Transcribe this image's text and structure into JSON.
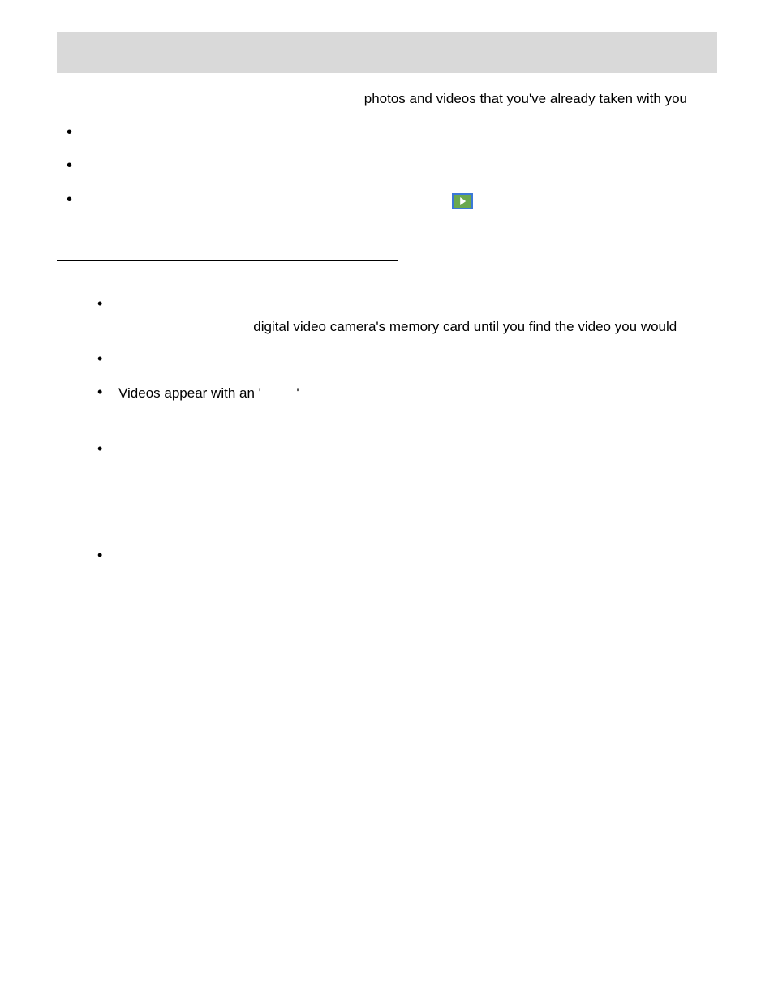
{
  "intro": {
    "t1": "photos and videos that you've already taken with you"
  },
  "list1": {
    "i3_a": " "
  },
  "list2": {
    "i1_a": "digital video camera's memory card until you find the video you would",
    "i3_a": "Videos appear with an '",
    "i3_b": "'"
  }
}
